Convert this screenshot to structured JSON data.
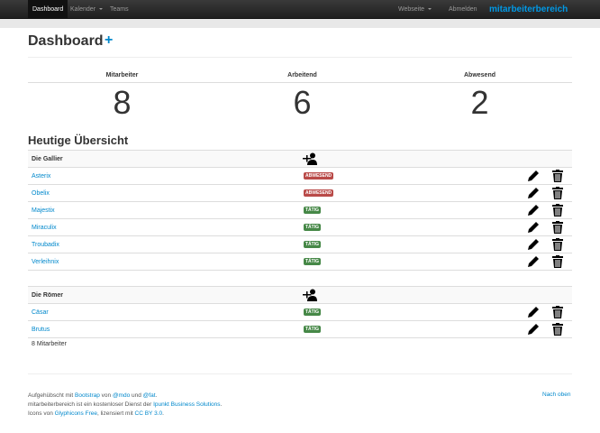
{
  "nav": {
    "dashboard": "Dashboard",
    "kalender": "Kalender",
    "teams": "Teams",
    "webseite": "Webseite",
    "abmelden": "Abmelden",
    "brand": "mitarbeiterbereich"
  },
  "header": {
    "title": "Dashboard",
    "plus": "+"
  },
  "stats": [
    {
      "label": "Mitarbeiter",
      "value": "8"
    },
    {
      "label": "Arbeitend",
      "value": "6"
    },
    {
      "label": "Abwesend",
      "value": "2"
    }
  ],
  "section_title": "Heutige Übersicht",
  "teams": [
    {
      "name": "Die Gallier",
      "members": [
        {
          "name": "Asterix",
          "status": "ABWESEND"
        },
        {
          "name": "Obelix",
          "status": "ABWESEND"
        },
        {
          "name": "Majestix",
          "status": "TÄTIG"
        },
        {
          "name": "Miraculix",
          "status": "TÄTIG"
        },
        {
          "name": "Troubadix",
          "status": "TÄTIG"
        },
        {
          "name": "Verleihnix",
          "status": "TÄTIG"
        }
      ]
    },
    {
      "name": "Die Römer",
      "members": [
        {
          "name": "Cäsar",
          "status": "TÄTIG"
        },
        {
          "name": "Brutus",
          "status": "TÄTIG"
        }
      ]
    }
  ],
  "summary": "8 Mitarbeiter",
  "footer": {
    "l1_a": "Aufgehübscht mit ",
    "l1_link1": "Bootstrap",
    "l1_b": " von ",
    "l1_link2": "@mdo",
    "l1_c": " und ",
    "l1_link3": "@fat",
    "l1_d": ".",
    "l2_a": "mitarbeiterbereich ist ein kostenloser Dienst der ",
    "l2_link": "Ipunkt Business Solutions",
    "l2_b": ".",
    "l3_a": "Icons von ",
    "l3_link1": "Glyphicons Free",
    "l3_b": ", lizensiert mit ",
    "l3_link2": "CC BY 3.0",
    "l3_c": ".",
    "to_top": "Nach oben"
  },
  "colors": {
    "link": "#0088cc",
    "brand": "#0099e6",
    "absent": "#b94a48",
    "active": "#468847"
  }
}
